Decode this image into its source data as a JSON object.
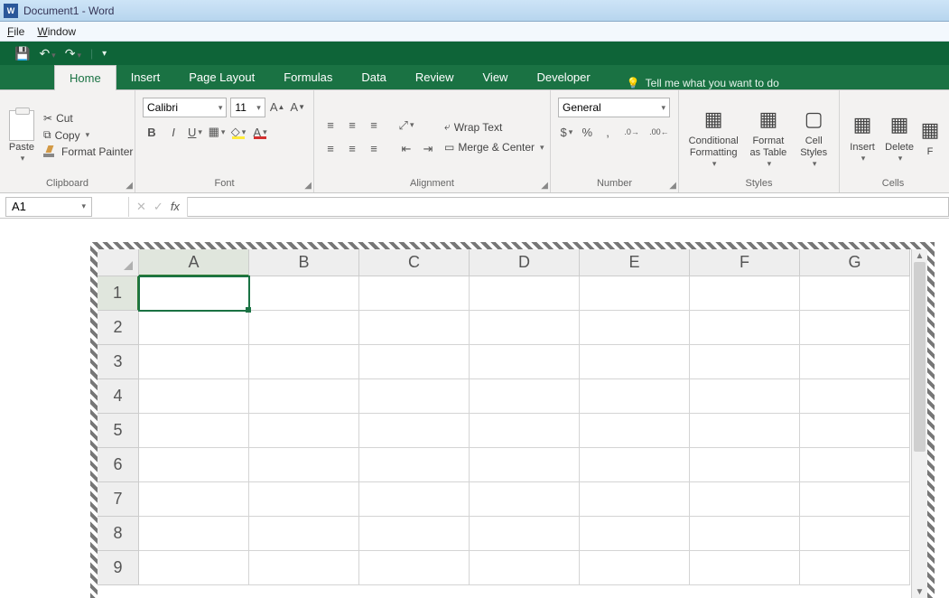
{
  "title": "Document1 - Word",
  "menu": {
    "file": "File",
    "window": "Window"
  },
  "tabs": [
    "Home",
    "Insert",
    "Page Layout",
    "Formulas",
    "Data",
    "Review",
    "View",
    "Developer"
  ],
  "active_tab": "Home",
  "tellme": "Tell me what you want to do",
  "clipboard": {
    "paste": "Paste",
    "cut": "Cut",
    "copy": "Copy",
    "format_painter": "Format Painter",
    "label": "Clipboard"
  },
  "font": {
    "name": "Calibri",
    "size": "11",
    "label": "Font"
  },
  "alignment": {
    "wrap": "Wrap Text",
    "merge": "Merge & Center",
    "label": "Alignment"
  },
  "number": {
    "format": "General",
    "currency": "$",
    "percent": "%",
    "comma": ",",
    "inc": "←.0 .00",
    "dec": ".00 →.0",
    "label": "Number"
  },
  "styles": {
    "cond": "Conditional Formatting",
    "fmt_table": "Format as Table",
    "cell_styles": "Cell Styles",
    "label": "Styles"
  },
  "cells": {
    "insert": "Insert",
    "delete": "Delete",
    "label": "Cells"
  },
  "namebox": "A1",
  "fx": "fx",
  "columns": [
    "A",
    "B",
    "C",
    "D",
    "E",
    "F",
    "G"
  ],
  "rows": [
    "1",
    "2",
    "3",
    "4",
    "5",
    "6",
    "7",
    "8",
    "9"
  ],
  "active_cell": "A1"
}
